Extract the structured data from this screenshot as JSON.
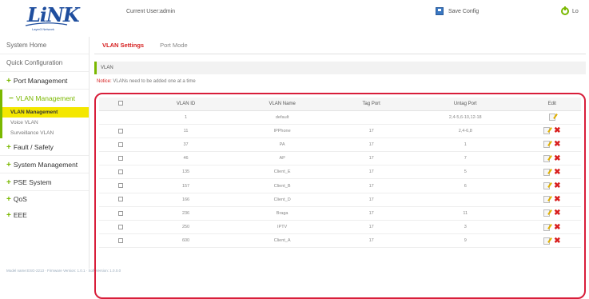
{
  "header": {
    "logo_text": "LiNK",
    "logo_sub": "Layer3 Network",
    "user": "Current User:admin",
    "save_config": "Save Config",
    "logout": "Lo"
  },
  "sidebar": {
    "system_home": "System Home",
    "quick_config": "Quick Configuration",
    "port_mgmt": "Port Management",
    "vlan_mgmt": "VLAN Management",
    "sub_vlan_mgmt": "VLAN Management",
    "sub_voice_vlan": "Voice VLAN",
    "sub_surveillance_vlan": "Surveillance VLAN",
    "fault_safety": "Fault / Safety",
    "system_mgmt": "System Management",
    "pse_system": "PSE System",
    "qos": "QoS",
    "eee": "EEE",
    "plus": "+",
    "minus": "−"
  },
  "main": {
    "tabs": [
      "VLAN Settings",
      "Port Mode"
    ],
    "section_title": "VLAN",
    "notice_label": "Notice:",
    "notice_text": "VLANs need to be added one at a time",
    "table": {
      "headers": [
        "VLAN ID",
        "VLAN Name",
        "Tag Port",
        "Untag Port",
        "Edit"
      ],
      "rows": [
        {
          "id": "1",
          "name": "default",
          "tag": "",
          "untag": "2,4-5,6-10,12-18",
          "deletable": false
        },
        {
          "id": "11",
          "name": "IPPhone",
          "tag": "17",
          "untag": "2,4-6,8",
          "deletable": true
        },
        {
          "id": "37",
          "name": "PA",
          "tag": "17",
          "untag": "1",
          "deletable": true
        },
        {
          "id": "46",
          "name": "AP",
          "tag": "17",
          "untag": "7",
          "deletable": true
        },
        {
          "id": "135",
          "name": "Client_E",
          "tag": "17",
          "untag": "5",
          "deletable": true
        },
        {
          "id": "157",
          "name": "Client_B",
          "tag": "17",
          "untag": "6",
          "deletable": true
        },
        {
          "id": "166",
          "name": "Client_D",
          "tag": "17",
          "untag": "",
          "deletable": true
        },
        {
          "id": "236",
          "name": "Braga",
          "tag": "17",
          "untag": "11",
          "deletable": true
        },
        {
          "id": "250",
          "name": "IPTV",
          "tag": "17",
          "untag": "3",
          "deletable": true
        },
        {
          "id": "600",
          "name": "Client_A",
          "tag": "17",
          "untag": "9",
          "deletable": true
        }
      ]
    }
  },
  "footer": {
    "text": "Model name:ESG-2213 · Firmware Version: 1.0.1 · Soft Version: 1.0.0.0"
  },
  "colors": {
    "accent_green": "#7ab800",
    "active_red": "#d62020",
    "highlight_yellow": "#f4e700",
    "annotation_red": "#d81e3a"
  }
}
